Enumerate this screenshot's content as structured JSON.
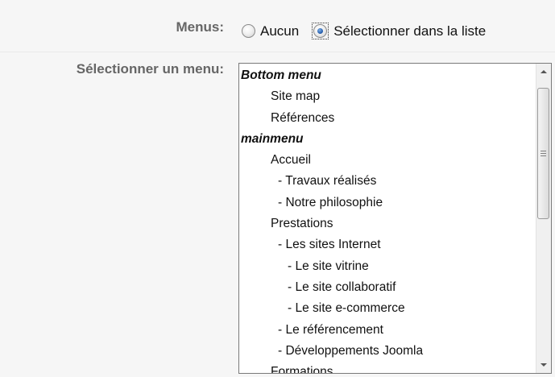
{
  "menus_row": {
    "label": "Menus:",
    "options": [
      {
        "label": "Aucun",
        "checked": false
      },
      {
        "label": "Sélectionner dans la liste",
        "checked": true
      }
    ]
  },
  "select_row": {
    "label": "Sélectionner un menu:",
    "items": [
      {
        "text": "Bottom menu",
        "kind": "group"
      },
      {
        "text": "Site map",
        "kind": "l1"
      },
      {
        "text": "Références",
        "kind": "l1"
      },
      {
        "text": "mainmenu",
        "kind": "group"
      },
      {
        "text": "Accueil",
        "kind": "l1"
      },
      {
        "text": "- Travaux réalisés",
        "kind": "l2"
      },
      {
        "text": "- Notre philosophie",
        "kind": "l2"
      },
      {
        "text": "Prestations",
        "kind": "l1"
      },
      {
        "text": "- Les sites Internet",
        "kind": "l2"
      },
      {
        "text": "- Le site vitrine",
        "kind": "l3"
      },
      {
        "text": "- Le site collaboratif",
        "kind": "l3"
      },
      {
        "text": "- Le site e-commerce",
        "kind": "l3"
      },
      {
        "text": "- Le référencement",
        "kind": "l2"
      },
      {
        "text": "- Développements Joomla",
        "kind": "l2"
      },
      {
        "text": "Formations",
        "kind": "l1"
      }
    ]
  },
  "icons": {
    "radio_unchecked": "radio-unchecked-icon",
    "radio_checked": "radio-checked-icon",
    "scroll_up": "scroll-up-arrow-icon",
    "scroll_down": "scroll-down-arrow-icon",
    "thumb_grip": "scroll-thumb-grip-icon"
  },
  "colors": {
    "row_background": "#f6f6f6",
    "label_text": "#666666",
    "radio_accent": "#2b62b0"
  }
}
